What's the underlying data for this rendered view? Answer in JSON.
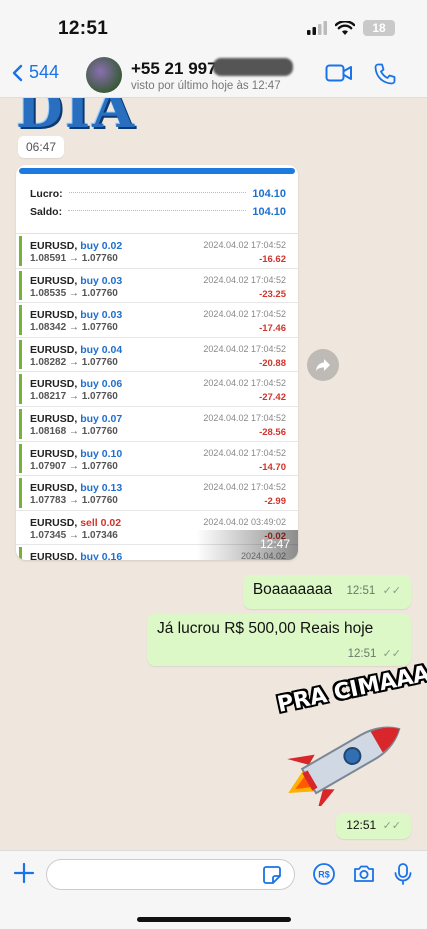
{
  "status_bar": {
    "time": "12:51",
    "battery": "18"
  },
  "header": {
    "back_count": "544",
    "contact_name": "+55 21 997",
    "last_seen": "visto por último hoje às 12:47"
  },
  "chat": {
    "image_text": "DIA",
    "time_chip": "06:47",
    "trade_card": {
      "summary": [
        {
          "label": "Lucro:",
          "value": "104.10"
        },
        {
          "label": "Saldo:",
          "value": "104.10"
        }
      ],
      "trades": [
        {
          "pair": "EURUSD,",
          "action": "buy 0.02",
          "prices": "1.08591 → 1.07760",
          "date": "2024.04.02 17:04:52",
          "profit": "-16.62",
          "type": "buy"
        },
        {
          "pair": "EURUSD,",
          "action": "buy 0.03",
          "prices": "1.08535 → 1.07760",
          "date": "2024.04.02 17:04:52",
          "profit": "-23.25",
          "type": "buy"
        },
        {
          "pair": "EURUSD,",
          "action": "buy 0.03",
          "prices": "1.08342 → 1.07760",
          "date": "2024.04.02 17:04:52",
          "profit": "-17.46",
          "type": "buy"
        },
        {
          "pair": "EURUSD,",
          "action": "buy 0.04",
          "prices": "1.08282 → 1.07760",
          "date": "2024.04.02 17:04:52",
          "profit": "-20.88",
          "type": "buy"
        },
        {
          "pair": "EURUSD,",
          "action": "buy 0.06",
          "prices": "1.08217 → 1.07760",
          "date": "2024.04.02 17:04:52",
          "profit": "-27.42",
          "type": "buy"
        },
        {
          "pair": "EURUSD,",
          "action": "buy 0.07",
          "prices": "1.08168 → 1.07760",
          "date": "2024.04.02 17:04:52",
          "profit": "-28.56",
          "type": "buy"
        },
        {
          "pair": "EURUSD,",
          "action": "buy 0.10",
          "prices": "1.07907 → 1.07760",
          "date": "2024.04.02 17:04:52",
          "profit": "-14.70",
          "type": "buy"
        },
        {
          "pair": "EURUSD,",
          "action": "buy 0.13",
          "prices": "1.07783 → 1.07760",
          "date": "2024.04.02 17:04:52",
          "profit": "-2.99",
          "type": "buy"
        },
        {
          "pair": "EURUSD,",
          "action": "sell 0.02",
          "prices": "1.07345 → 1.07346",
          "date": "2024.04.02 03:49:02",
          "profit": "-0.02",
          "type": "sell"
        },
        {
          "pair": "EURUSD,",
          "action": "buy 0.16",
          "prices": "",
          "date": "2024.04.02",
          "profit": "",
          "type": "buy"
        }
      ],
      "time": "12:47"
    },
    "messages": [
      {
        "text": "Boaaaaaaa",
        "time": "12:51"
      },
      {
        "text": "Já lucrou R$ 500,00 Reais hoje",
        "time": "12:51"
      }
    ],
    "sticker_text": "PRA CIMAAA!",
    "sticker_time": "12:51"
  },
  "input": {
    "placeholder": ""
  },
  "colors": {
    "outgoing_bubble": "#dcf8c6",
    "accent": "#1a73e8",
    "buy": "#1f6fcf",
    "sell": "#d0342c",
    "profit_negative": "#d0342c"
  }
}
